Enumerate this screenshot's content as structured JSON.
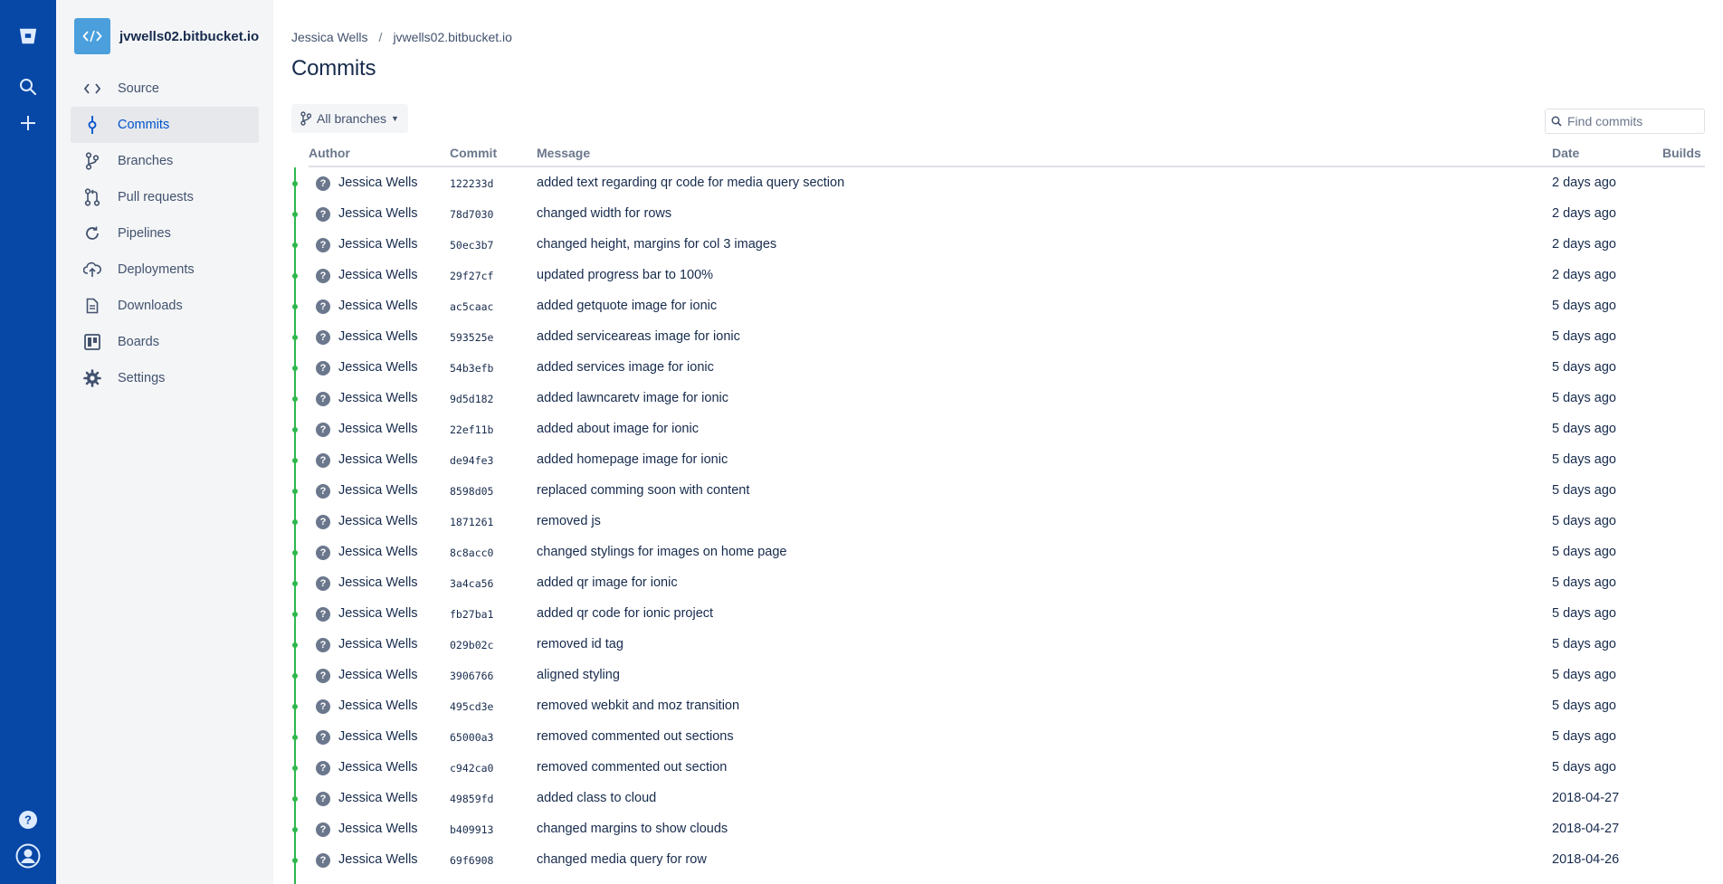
{
  "repo": {
    "name": "jvwells02.bitbucket.io",
    "avatar_icon": "code-icon",
    "avatar_color": "#4a9fdc"
  },
  "rail": {
    "logo_icon": "bitbucket-logo",
    "search_icon": "search-icon",
    "create_icon": "plus-icon",
    "help_icon": "help-icon",
    "profile_icon": "user-icon"
  },
  "nav": {
    "items": [
      {
        "label": "Source",
        "icon": "code-icon"
      },
      {
        "label": "Commits",
        "icon": "commit-icon"
      },
      {
        "label": "Branches",
        "icon": "branch-icon"
      },
      {
        "label": "Pull requests",
        "icon": "pull-request-icon"
      },
      {
        "label": "Pipelines",
        "icon": "pipelines-icon"
      },
      {
        "label": "Deployments",
        "icon": "cloud-upload-icon"
      },
      {
        "label": "Downloads",
        "icon": "document-icon"
      },
      {
        "label": "Boards",
        "icon": "board-icon"
      },
      {
        "label": "Settings",
        "icon": "gear-icon"
      }
    ],
    "active": "Commits"
  },
  "breadcrumb": {
    "user": "Jessica Wells",
    "separator": "/",
    "repo": "jvwells02.bitbucket.io"
  },
  "page": {
    "title": "Commits"
  },
  "branch_filter": {
    "label": "All branches"
  },
  "search": {
    "placeholder": "Find commits"
  },
  "table": {
    "headers": {
      "author": "Author",
      "commit": "Commit",
      "message": "Message",
      "date": "Date",
      "builds": "Builds"
    },
    "rows": [
      {
        "author": "Jessica Wells",
        "hash": "122233d",
        "message": "added text regarding qr code for media query section",
        "date": "2 days ago"
      },
      {
        "author": "Jessica Wells",
        "hash": "78d7030",
        "message": "changed width for rows",
        "date": "2 days ago"
      },
      {
        "author": "Jessica Wells",
        "hash": "50ec3b7",
        "message": "changed height, margins for col 3 images",
        "date": "2 days ago"
      },
      {
        "author": "Jessica Wells",
        "hash": "29f27cf",
        "message": "updated progress bar to 100%",
        "date": "2 days ago"
      },
      {
        "author": "Jessica Wells",
        "hash": "ac5caac",
        "message": "added getquote image for ionic",
        "date": "5 days ago"
      },
      {
        "author": "Jessica Wells",
        "hash": "593525e",
        "message": "added serviceareas image for ionic",
        "date": "5 days ago"
      },
      {
        "author": "Jessica Wells",
        "hash": "54b3efb",
        "message": "added services image for ionic",
        "date": "5 days ago"
      },
      {
        "author": "Jessica Wells",
        "hash": "9d5d182",
        "message": "added lawncaretv image for ionic",
        "date": "5 days ago"
      },
      {
        "author": "Jessica Wells",
        "hash": "22ef11b",
        "message": "added about image for ionic",
        "date": "5 days ago"
      },
      {
        "author": "Jessica Wells",
        "hash": "de94fe3",
        "message": "added homepage image for ionic",
        "date": "5 days ago"
      },
      {
        "author": "Jessica Wells",
        "hash": "8598d05",
        "message": "replaced comming soon with content",
        "date": "5 days ago"
      },
      {
        "author": "Jessica Wells",
        "hash": "1871261",
        "message": "removed js",
        "date": "5 days ago"
      },
      {
        "author": "Jessica Wells",
        "hash": "8c8acc0",
        "message": "changed stylings for images on home page",
        "date": "5 days ago"
      },
      {
        "author": "Jessica Wells",
        "hash": "3a4ca56",
        "message": "added qr image for ionic",
        "date": "5 days ago"
      },
      {
        "author": "Jessica Wells",
        "hash": "fb27ba1",
        "message": "added qr code for ionic project",
        "date": "5 days ago"
      },
      {
        "author": "Jessica Wells",
        "hash": "029b02c",
        "message": "removed id tag",
        "date": "5 days ago"
      },
      {
        "author": "Jessica Wells",
        "hash": "3906766",
        "message": "aligned styling",
        "date": "5 days ago"
      },
      {
        "author": "Jessica Wells",
        "hash": "495cd3e",
        "message": "removed webkit and moz transition",
        "date": "5 days ago"
      },
      {
        "author": "Jessica Wells",
        "hash": "65000a3",
        "message": "removed commented out sections",
        "date": "5 days ago"
      },
      {
        "author": "Jessica Wells",
        "hash": "c942ca0",
        "message": "removed commented out section",
        "date": "5 days ago"
      },
      {
        "author": "Jessica Wells",
        "hash": "49859fd",
        "message": "added class to cloud",
        "date": "2018-04-27"
      },
      {
        "author": "Jessica Wells",
        "hash": "b409913",
        "message": "changed margins to show clouds",
        "date": "2018-04-27"
      },
      {
        "author": "Jessica Wells",
        "hash": "69f6908",
        "message": "changed media query for row",
        "date": "2018-04-26"
      }
    ]
  },
  "colors": {
    "rail": "#0747a6",
    "sidebar": "#f4f5f7",
    "active": "#0052cc",
    "graph": "#2eb84c",
    "avatar_unknown": "#6b778c"
  }
}
